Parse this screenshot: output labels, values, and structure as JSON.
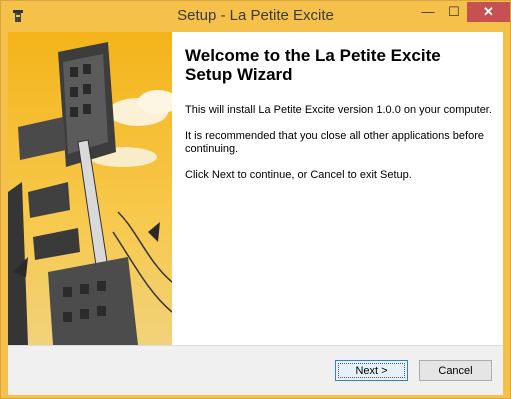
{
  "window": {
    "title": "Setup - La Petite Excite",
    "controls": {
      "minimize": "—",
      "maximize": "☐",
      "close": "✕"
    }
  },
  "content": {
    "heading_line1": "Welcome to the La Petite Excite",
    "heading_line2": "Setup Wizard",
    "paragraph1": "This will install La Petite Excite version 1.0.0 on your computer.",
    "paragraph2": "It is recommended that you close all other applications before continuing.",
    "paragraph3": "Click Next to continue, or Cancel to exit Setup."
  },
  "buttons": {
    "next": "Next >",
    "cancel": "Cancel"
  },
  "colors": {
    "titlebar": "#f6c14b",
    "close_button": "#c75050",
    "accent_border": "#3c7fb1"
  },
  "icons": {
    "app": "installer-app-icon",
    "side": "city-tower-illustration"
  }
}
